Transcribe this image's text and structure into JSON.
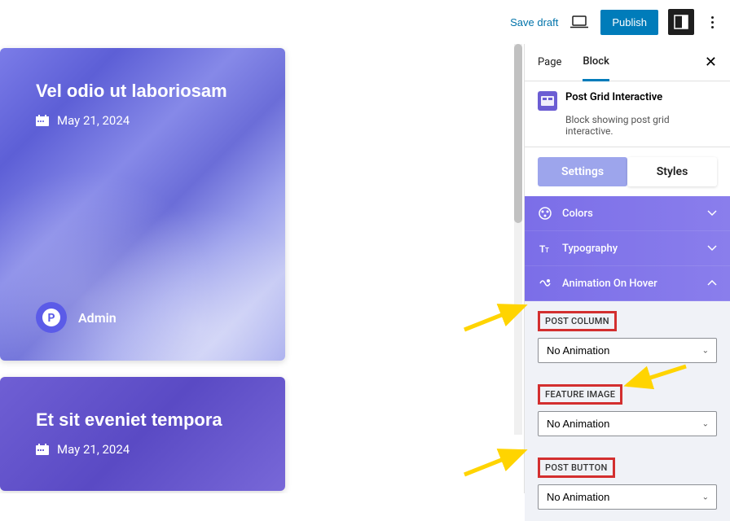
{
  "topbar": {
    "save_draft": "Save draft",
    "publish": "Publish"
  },
  "posts": [
    {
      "title": "Vel odio ut laboriosam",
      "date": "May 21, 2024",
      "author": "Admin"
    },
    {
      "title": "Et sit eveniet tempora",
      "date": "May 21, 2024"
    }
  ],
  "sidebar": {
    "tabs": {
      "page": "Page",
      "block": "Block"
    },
    "block": {
      "name": "Post Grid Interactive",
      "desc": "Block showing post grid interactive."
    },
    "subtabs": {
      "settings": "Settings",
      "styles": "Styles"
    },
    "panels": {
      "colors": "Colors",
      "typography": "Typography",
      "animation": "Animation On Hover"
    },
    "controls": {
      "post_column": {
        "label": "POST COLUMN",
        "value": "No Animation"
      },
      "feature_image": {
        "label": "FEATURE IMAGE",
        "value": "No Animation"
      },
      "post_button": {
        "label": "POST BUTTON",
        "value": "No Animation"
      }
    }
  }
}
